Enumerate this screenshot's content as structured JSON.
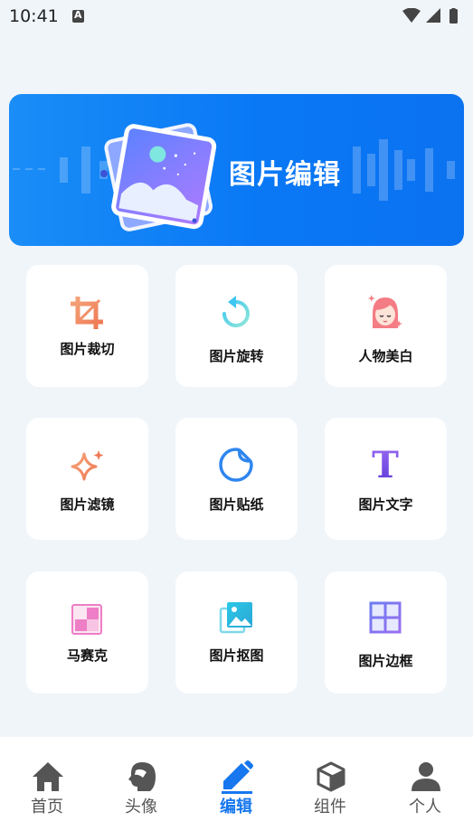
{
  "status_bar": {
    "time": "10:41",
    "notif_letter": "A"
  },
  "banner": {
    "title": "图片编辑"
  },
  "tools": [
    {
      "label": "图片裁切",
      "icon": "crop-icon"
    },
    {
      "label": "图片旋转",
      "icon": "rotate-icon"
    },
    {
      "label": "人物美白",
      "icon": "face-icon"
    },
    {
      "label": "图片滤镜",
      "icon": "sparkle-icon"
    },
    {
      "label": "图片贴纸",
      "icon": "sticker-icon"
    },
    {
      "label": "图片文字",
      "icon": "text-icon"
    },
    {
      "label": "马赛克",
      "icon": "mosaic-icon"
    },
    {
      "label": "图片抠图",
      "icon": "image-cutout-icon"
    },
    {
      "label": "图片边框",
      "icon": "frame-icon"
    }
  ],
  "nav": [
    {
      "label": "首页",
      "icon": "home-icon",
      "active": false
    },
    {
      "label": "头像",
      "icon": "avatar-head-icon",
      "active": false
    },
    {
      "label": "编辑",
      "icon": "pencil-icon",
      "active": true
    },
    {
      "label": "组件",
      "icon": "cube-icon",
      "active": false
    },
    {
      "label": "个人",
      "icon": "person-icon",
      "active": false
    }
  ],
  "colors": {
    "accent": "#1677ee",
    "banner": "#0a78f5",
    "background": "#f0f5fa"
  }
}
